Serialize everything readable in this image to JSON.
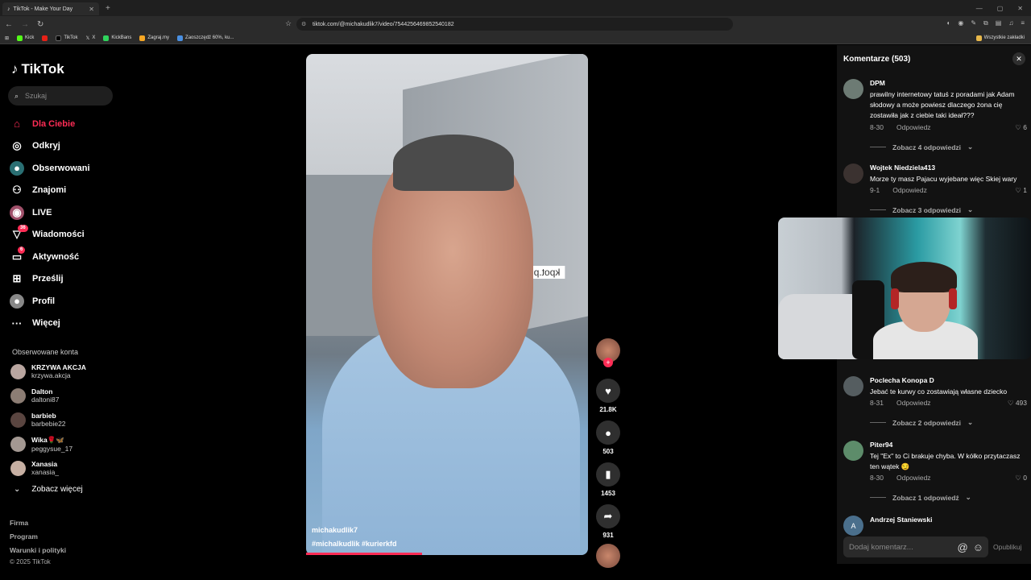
{
  "browser": {
    "tab_title": "TikTok - Make Your Day",
    "url": "tiktok.com/@michakudlik7/video/7544256469852540182",
    "bookmarks": [
      "Kick",
      "TikTok",
      "X",
      "KickBans",
      "Zagraj.my",
      "Zaoszczędź 60%, ku..."
    ],
    "bookmarks_right": "Wszystkie zakładki"
  },
  "sidebar": {
    "logo": "TikTok",
    "search_placeholder": "Szukaj",
    "nav": [
      {
        "label": "Dla Ciebie",
        "icon": "home-icon",
        "active": true
      },
      {
        "label": "Odkryj",
        "icon": "compass-icon"
      },
      {
        "label": "Obserwowani",
        "icon": "following-icon"
      },
      {
        "label": "Znajomi",
        "icon": "friends-icon"
      },
      {
        "label": "LIVE",
        "icon": "live-icon"
      },
      {
        "label": "Wiadomości",
        "icon": "messages-icon",
        "badge": "36"
      },
      {
        "label": "Aktywność",
        "icon": "activity-icon",
        "badge": "6"
      },
      {
        "label": "Prześlij",
        "icon": "upload-icon"
      },
      {
        "label": "Profil",
        "icon": "profile-icon"
      },
      {
        "label": "Więcej",
        "icon": "more-icon"
      }
    ],
    "following_title": "Obserwowane konta",
    "accounts": [
      {
        "name": "KRZYWA AKCJA",
        "handle": "krzywa.akcja"
      },
      {
        "name": "Dalton",
        "handle": "daltoni87"
      },
      {
        "name": "barbieb",
        "handle": "barbebie22"
      },
      {
        "name": "Wika🌹🦋",
        "handle": "peggysue_17"
      },
      {
        "name": "Xanasia",
        "handle": "xanasia_"
      }
    ],
    "see_more": "Zobacz więcej",
    "footer": [
      "Firma",
      "Program",
      "Warunki i polityki",
      "© 2025 TikTok"
    ]
  },
  "video": {
    "author": "michakudlik7",
    "hashtags": "#michalkudlik  #kurierkfd",
    "sign_text": "kpot.pl",
    "progress": 0.41
  },
  "actions": {
    "likes": "21.8K",
    "comments": "503",
    "saves": "1453",
    "shares": "931"
  },
  "comments": {
    "title": "Komentarze (503)",
    "reply_label": "Odpowiedz",
    "items": [
      {
        "user": "DPM",
        "text": "prawilny internetowy tatuś z poradami jak Adam słodowy a może powiesz dlaczego żona cię zostawiła jak z ciebie taki ideał???",
        "date": "8-30",
        "likes": "6",
        "replies": "Zobacz 4 odpowiedzi"
      },
      {
        "user": "Wojtek Niedziela413",
        "text": "Morze ty masz Pajacu wyjebane więc Skiej wary",
        "date": "9-1",
        "likes": "1",
        "replies": "Zobacz 3 odpowiedzi"
      },
      {
        "user": "Poclecha Konopa D",
        "text": "Jebać te kurwy co zostawiają własne dziecko",
        "date": "8-31",
        "likes": "493",
        "replies": "Zobacz 2 odpowiedzi"
      },
      {
        "user": "Piter94",
        "text": "Tej \"Ex\" to Ci brakuje chyba. W kółko przytaczasz ten wątek 😏",
        "date": "8-30",
        "likes": "0",
        "replies": "Zobacz 1 odpowiedź"
      },
      {
        "user": "Andrzej Staniewski",
        "text": "",
        "date": "",
        "likes": "",
        "replies": ""
      }
    ],
    "hidden_reply": "Zobacz 4 odpowiedzi",
    "input_placeholder": "Dodaj komentarz...",
    "publish": "Opublikuj"
  }
}
